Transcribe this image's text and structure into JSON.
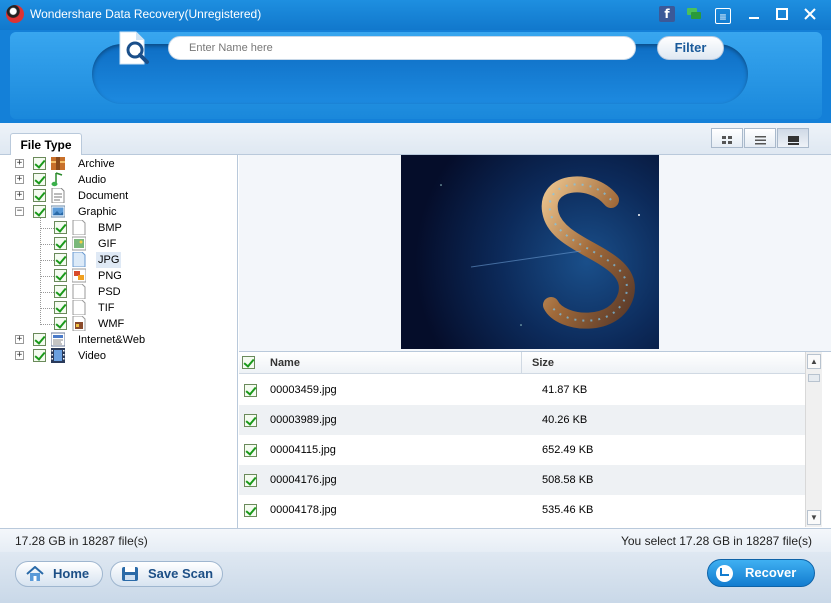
{
  "window": {
    "title": "Wondershare Data Recovery(Unregistered)",
    "controls": [
      "facebook-icon",
      "feedback-icon",
      "menu-icon",
      "minimize-icon",
      "maximize-icon",
      "close-icon"
    ]
  },
  "search": {
    "placeholder": "Enter Name here",
    "value": "",
    "filter_label": "Filter"
  },
  "tabs": {
    "file_type_label": "File Type"
  },
  "view_modes": [
    "thumbnail-view",
    "list-view",
    "preview-view"
  ],
  "view_modes_active": "preview-view",
  "tree": [
    {
      "label": "Archive",
      "checked": true,
      "expanded": false,
      "icon": "archive-icon"
    },
    {
      "label": "Audio",
      "checked": true,
      "expanded": false,
      "icon": "audio-icon"
    },
    {
      "label": "Document",
      "checked": true,
      "expanded": false,
      "icon": "document-icon"
    },
    {
      "label": "Graphic",
      "checked": true,
      "expanded": true,
      "icon": "graphic-icon",
      "children": [
        {
          "label": "BMP",
          "checked": true,
          "icon": "bmp-file-icon"
        },
        {
          "label": "GIF",
          "checked": true,
          "icon": "gif-file-icon"
        },
        {
          "label": "JPG",
          "checked": true,
          "icon": "jpg-file-icon",
          "selected": true
        },
        {
          "label": "PNG",
          "checked": true,
          "icon": "png-file-icon"
        },
        {
          "label": "PSD",
          "checked": true,
          "icon": "psd-file-icon"
        },
        {
          "label": "TIF",
          "checked": true,
          "icon": "tif-file-icon"
        },
        {
          "label": "WMF",
          "checked": true,
          "icon": "wmf-file-icon"
        }
      ]
    },
    {
      "label": "Internet&Web",
      "checked": true,
      "expanded": false,
      "icon": "internet-icon"
    },
    {
      "label": "Video",
      "checked": true,
      "expanded": false,
      "icon": "video-icon"
    }
  ],
  "list": {
    "columns": {
      "name": "Name",
      "size": "Size"
    },
    "rows": [
      {
        "name": "00003459.jpg",
        "size": "41.87 KB",
        "checked": true
      },
      {
        "name": "00003989.jpg",
        "size": "40.26 KB",
        "checked": true
      },
      {
        "name": "00004115.jpg",
        "size": "652.49 KB",
        "checked": true
      },
      {
        "name": "00004176.jpg",
        "size": "508.58 KB",
        "checked": true
      },
      {
        "name": "00004178.jpg",
        "size": "535.46 KB",
        "checked": true
      }
    ]
  },
  "status": {
    "left": "17.28 GB in 18287 file(s)",
    "right": "You select 17.28 GB in 18287 file(s)"
  },
  "buttons": {
    "home": "Home",
    "save_scan": "Save Scan",
    "recover": "Recover"
  },
  "colors": {
    "accent": "#1480d8",
    "recover": "#1f8fe0",
    "check": "#1a9a1a"
  }
}
